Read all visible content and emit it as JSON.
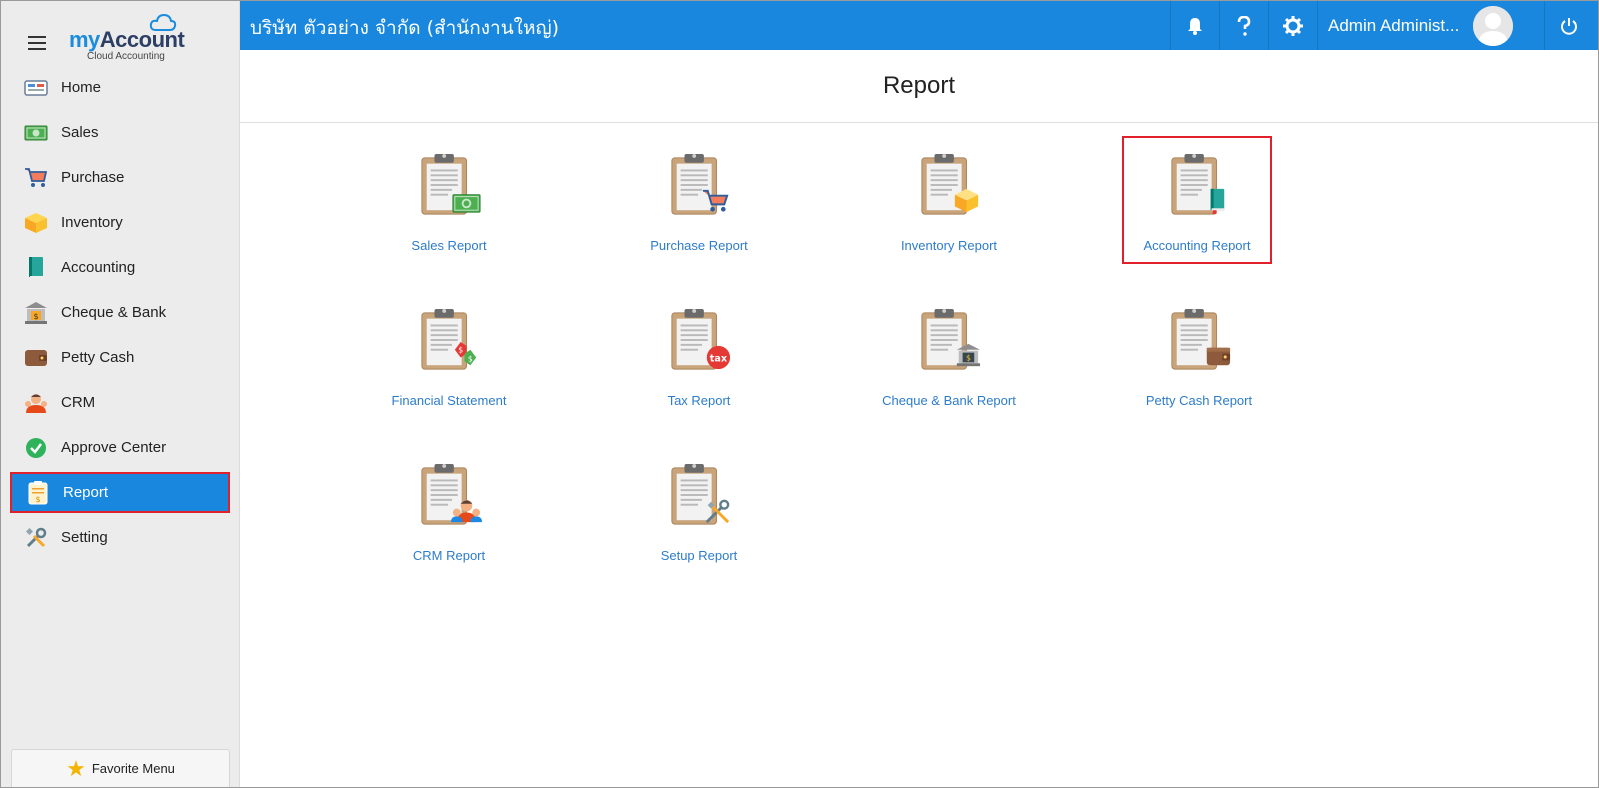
{
  "app": {
    "logo_my": "my",
    "logo_account": "Account",
    "logo_sub": "Cloud Accounting"
  },
  "sidebar": {
    "items": [
      {
        "label": "Home",
        "icon": "home-icon"
      },
      {
        "label": "Sales",
        "icon": "sales-money-icon"
      },
      {
        "label": "Purchase",
        "icon": "cart-icon"
      },
      {
        "label": "Inventory",
        "icon": "box-icon"
      },
      {
        "label": "Accounting",
        "icon": "book-icon"
      },
      {
        "label": "Cheque & Bank",
        "icon": "bank-icon"
      },
      {
        "label": "Petty Cash",
        "icon": "wallet-icon"
      },
      {
        "label": "CRM",
        "icon": "people-icon"
      },
      {
        "label": "Approve Center",
        "icon": "check-circle-icon"
      },
      {
        "label": "Report",
        "icon": "report-icon",
        "active": true
      },
      {
        "label": "Setting",
        "icon": "tools-icon"
      }
    ],
    "favorite_label": "Favorite Menu"
  },
  "topbar": {
    "company": "บริษัท ตัวอย่าง จำกัด (สำนักงานใหญ่)",
    "user_name": "Admin Administ...",
    "bar_color": "#1a87df"
  },
  "main": {
    "title": "Report",
    "reports": [
      {
        "label": "Sales Report",
        "badge": "money"
      },
      {
        "label": "Purchase Report",
        "badge": "cart"
      },
      {
        "label": "Inventory Report",
        "badge": "box"
      },
      {
        "label": "Accounting Report",
        "badge": "book",
        "selected": true
      },
      {
        "label": "Financial Statement",
        "badge": "exchange"
      },
      {
        "label": "Tax Report",
        "badge": "tax"
      },
      {
        "label": "Cheque & Bank Report",
        "badge": "bank"
      },
      {
        "label": "Petty Cash Report",
        "badge": "wallet"
      },
      {
        "label": "CRM Report",
        "badge": "people"
      },
      {
        "label": "Setup Report",
        "badge": "tools"
      }
    ],
    "tax_badge_text": "tax"
  }
}
